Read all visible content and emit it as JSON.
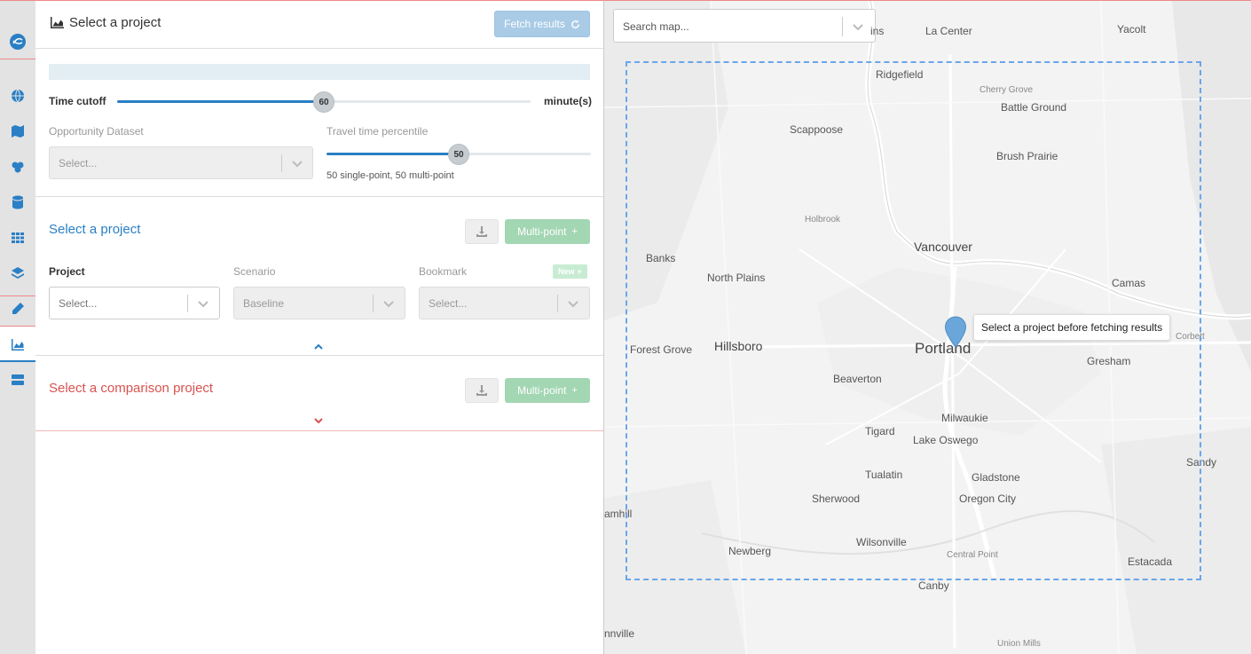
{
  "nav": {
    "items": [
      {
        "icon": "logo-icon"
      },
      {
        "icon": "globe-icon"
      },
      {
        "icon": "map-icon"
      },
      {
        "icon": "modifications-icon"
      },
      {
        "icon": "database-icon"
      },
      {
        "icon": "grid-icon"
      },
      {
        "icon": "layers-icon"
      },
      {
        "icon": "pencil-icon"
      },
      {
        "icon": "chart-icon"
      },
      {
        "icon": "server-icon"
      }
    ]
  },
  "header": {
    "title": "Select a project",
    "fetch_label": "Fetch results"
  },
  "settings": {
    "time_cutoff_label": "Time cutoff",
    "time_cutoff_value": "60",
    "time_cutoff_unit": "minute(s)",
    "time_cutoff_fraction": 0.5,
    "opportunity_label": "Opportunity Dataset",
    "opportunity_placeholder": "Select...",
    "percentile_label": "Travel time percentile",
    "percentile_value": "50",
    "percentile_fraction": 0.5,
    "percentile_note": "50 single-point, 50 multi-point"
  },
  "project_section": {
    "title": "Select a project",
    "multipoint_label": "Multi-point",
    "project_label": "Project",
    "project_placeholder": "Select...",
    "scenario_label": "Scenario",
    "scenario_value": "Baseline",
    "bookmark_label": "Bookmark",
    "bookmark_badge": "New",
    "bookmark_placeholder": "Select..."
  },
  "comparison_section": {
    "title": "Select a comparison project",
    "multipoint_label": "Multi-point"
  },
  "map": {
    "search_placeholder": "Search map...",
    "tooltip": "Select a project before fetching results",
    "labels": {
      "la_center": "La Center",
      "yacolt": "Yacolt",
      "ins": "ins",
      "ridgefield": "Ridgefield",
      "cherry_grove": "Cherry Grove",
      "battle_ground": "Battle Ground",
      "scappoose": "Scappoose",
      "brush_prairie": "Brush Prairie",
      "holbrook": "Holbrook",
      "vancouver": "Vancouver",
      "banks": "Banks",
      "north_plains": "North Plains",
      "camas": "Camas",
      "forest_grove": "Forest Grove",
      "hillsboro": "Hillsboro",
      "portland": "Portland",
      "gresham": "Gresham",
      "corbett": "Corbett",
      "beaverton": "Beaverton",
      "milwaukie": "Milwaukie",
      "tigard": "Tigard",
      "lake_oswego": "Lake Oswego",
      "sandy": "Sandy",
      "tualatin": "Tualatin",
      "gladstone": "Gladstone",
      "sherwood": "Sherwood",
      "oregon_city": "Oregon City",
      "amhill": "amhill",
      "wilsonville": "Wilsonville",
      "newberg": "Newberg",
      "central_point": "Central Point",
      "estacada": "Estacada",
      "canby": "Canby",
      "nnville": "nnville",
      "union_mills": "Union Mills"
    }
  }
}
